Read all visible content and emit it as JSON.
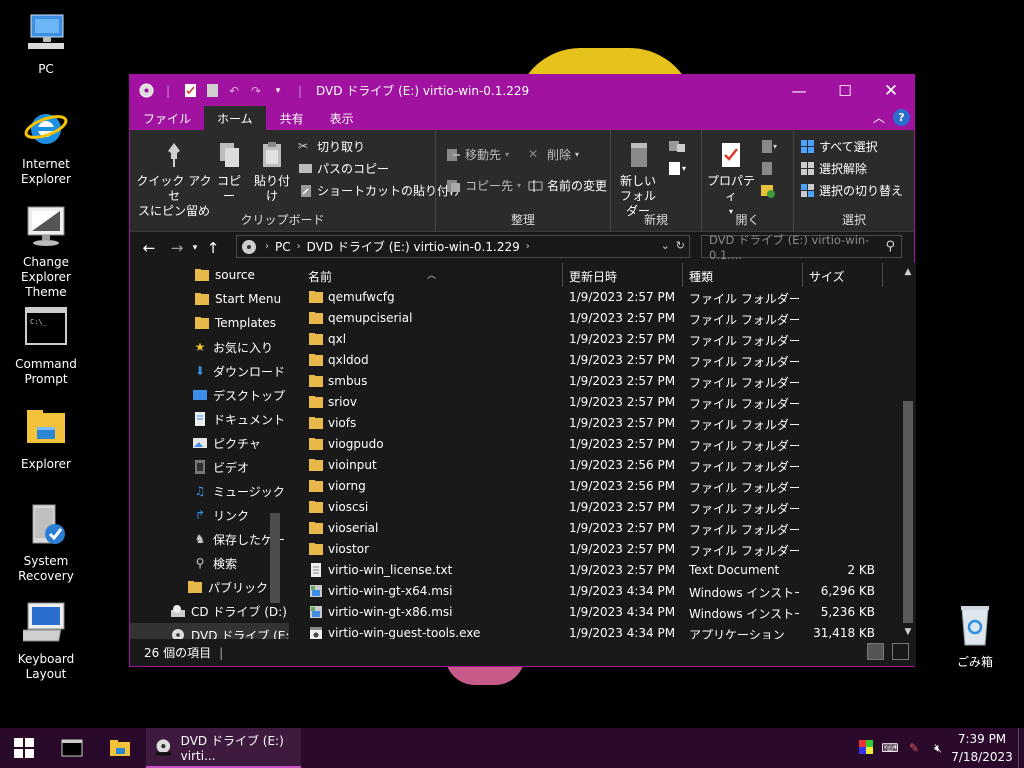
{
  "desktop": {
    "icons": [
      {
        "label": "PC"
      },
      {
        "label": "Internet Explorer"
      },
      {
        "label": "Change Explorer Theme"
      },
      {
        "label": "Command Prompt"
      },
      {
        "label": "Explorer"
      },
      {
        "label": "System Recovery"
      },
      {
        "label": "Keyboard Layout"
      }
    ],
    "recycle_bin": "ごみ箱"
  },
  "window": {
    "title": "DVD ドライブ (E:) virtio-win-0.1.229",
    "accent": "#a0129f",
    "tabs": [
      "ファイル",
      "ホーム",
      "共有",
      "表示"
    ],
    "active_tab": "ホーム",
    "ribbon": {
      "pin_label_1": "クイック アクセ",
      "pin_label_2": "スにピン留め",
      "copy": "コピー",
      "paste": "貼り付け",
      "cut": "切り取り",
      "copy_path": "パスのコピー",
      "paste_shortcut": "ショートカットの貼り付け",
      "clipboard_group": "クリップボード",
      "move_to": "移動先",
      "copy_to": "コピー先",
      "delete": "削除",
      "rename": "名前の変更",
      "organize_group": "整理",
      "new_folder_1": "新しい",
      "new_folder_2": "フォルダー",
      "new_group": "新規",
      "properties": "プロパティ",
      "open_group": "開く",
      "select_all": "すべて選択",
      "select_none": "選択解除",
      "invert_selection": "選択の切り替え",
      "select_group": "選択"
    },
    "address": {
      "crumbs": [
        "PC",
        "DVD ドライブ (E:) virtio-win-0.1.229"
      ],
      "search_placeholder": "DVD ドライブ (E:) virtio-win-0.1...."
    },
    "nav_items": [
      {
        "label": "source",
        "icon": "folder-icon"
      },
      {
        "label": "Start Menu",
        "icon": "folder-icon"
      },
      {
        "label": "Templates",
        "icon": "folder-icon"
      },
      {
        "label": "お気に入り",
        "icon": "star-icon"
      },
      {
        "label": "ダウンロード",
        "icon": "download-icon"
      },
      {
        "label": "デスクトップ",
        "icon": "desktop-icon"
      },
      {
        "label": "ドキュメント",
        "icon": "documents-icon"
      },
      {
        "label": "ピクチャ",
        "icon": "pictures-icon"
      },
      {
        "label": "ビデオ",
        "icon": "videos-icon"
      },
      {
        "label": "ミュージック",
        "icon": "music-icon"
      },
      {
        "label": "リンク",
        "icon": "links-icon"
      },
      {
        "label": "保存したゲー",
        "icon": "saved-games-icon"
      },
      {
        "label": "検索",
        "icon": "search-icon"
      },
      {
        "label": "パブリック",
        "icon": "folder-icon"
      },
      {
        "label": "CD ドライブ (D:)",
        "icon": "cd-drive-icon"
      },
      {
        "label": "DVD ドライブ (E:)",
        "icon": "dvd-drive-icon"
      }
    ],
    "columns": {
      "name": "名前",
      "date": "更新日時",
      "type": "種類",
      "size": "サイズ"
    },
    "files": [
      {
        "name": "qemufwcfg",
        "date": "1/9/2023 2:57 PM",
        "type": "ファイル フォルダー",
        "size": "",
        "kind": "folder"
      },
      {
        "name": "qemupciserial",
        "date": "1/9/2023 2:57 PM",
        "type": "ファイル フォルダー",
        "size": "",
        "kind": "folder"
      },
      {
        "name": "qxl",
        "date": "1/9/2023 2:57 PM",
        "type": "ファイル フォルダー",
        "size": "",
        "kind": "folder"
      },
      {
        "name": "qxldod",
        "date": "1/9/2023 2:57 PM",
        "type": "ファイル フォルダー",
        "size": "",
        "kind": "folder"
      },
      {
        "name": "smbus",
        "date": "1/9/2023 2:57 PM",
        "type": "ファイル フォルダー",
        "size": "",
        "kind": "folder"
      },
      {
        "name": "sriov",
        "date": "1/9/2023 2:57 PM",
        "type": "ファイル フォルダー",
        "size": "",
        "kind": "folder"
      },
      {
        "name": "viofs",
        "date": "1/9/2023 2:57 PM",
        "type": "ファイル フォルダー",
        "size": "",
        "kind": "folder"
      },
      {
        "name": "viogpudo",
        "date": "1/9/2023 2:57 PM",
        "type": "ファイル フォルダー",
        "size": "",
        "kind": "folder"
      },
      {
        "name": "vioinput",
        "date": "1/9/2023 2:56 PM",
        "type": "ファイル フォルダー",
        "size": "",
        "kind": "folder"
      },
      {
        "name": "viorng",
        "date": "1/9/2023 2:56 PM",
        "type": "ファイル フォルダー",
        "size": "",
        "kind": "folder"
      },
      {
        "name": "vioscsi",
        "date": "1/9/2023 2:57 PM",
        "type": "ファイル フォルダー",
        "size": "",
        "kind": "folder"
      },
      {
        "name": "vioserial",
        "date": "1/9/2023 2:57 PM",
        "type": "ファイル フォルダー",
        "size": "",
        "kind": "folder"
      },
      {
        "name": "viostor",
        "date": "1/9/2023 2:57 PM",
        "type": "ファイル フォルダー",
        "size": "",
        "kind": "folder"
      },
      {
        "name": "virtio-win_license.txt",
        "date": "1/9/2023 2:57 PM",
        "type": "Text Document",
        "size": "2 KB",
        "kind": "text"
      },
      {
        "name": "virtio-win-gt-x64.msi",
        "date": "1/9/2023 4:34 PM",
        "type": "Windows インストー...",
        "size": "6,296 KB",
        "kind": "msi"
      },
      {
        "name": "virtio-win-gt-x86.msi",
        "date": "1/9/2023 4:34 PM",
        "type": "Windows インストー...",
        "size": "5,236 KB",
        "kind": "msi"
      },
      {
        "name": "virtio-win-guest-tools.exe",
        "date": "1/9/2023 4:34 PM",
        "type": "アプリケーション",
        "size": "31,418 KB",
        "kind": "exe"
      }
    ],
    "status": "26 個の項目"
  },
  "taskbar": {
    "task_label": "DVD ドライブ (E:) virti...",
    "time": "7:39 PM",
    "date": "7/18/2023"
  }
}
